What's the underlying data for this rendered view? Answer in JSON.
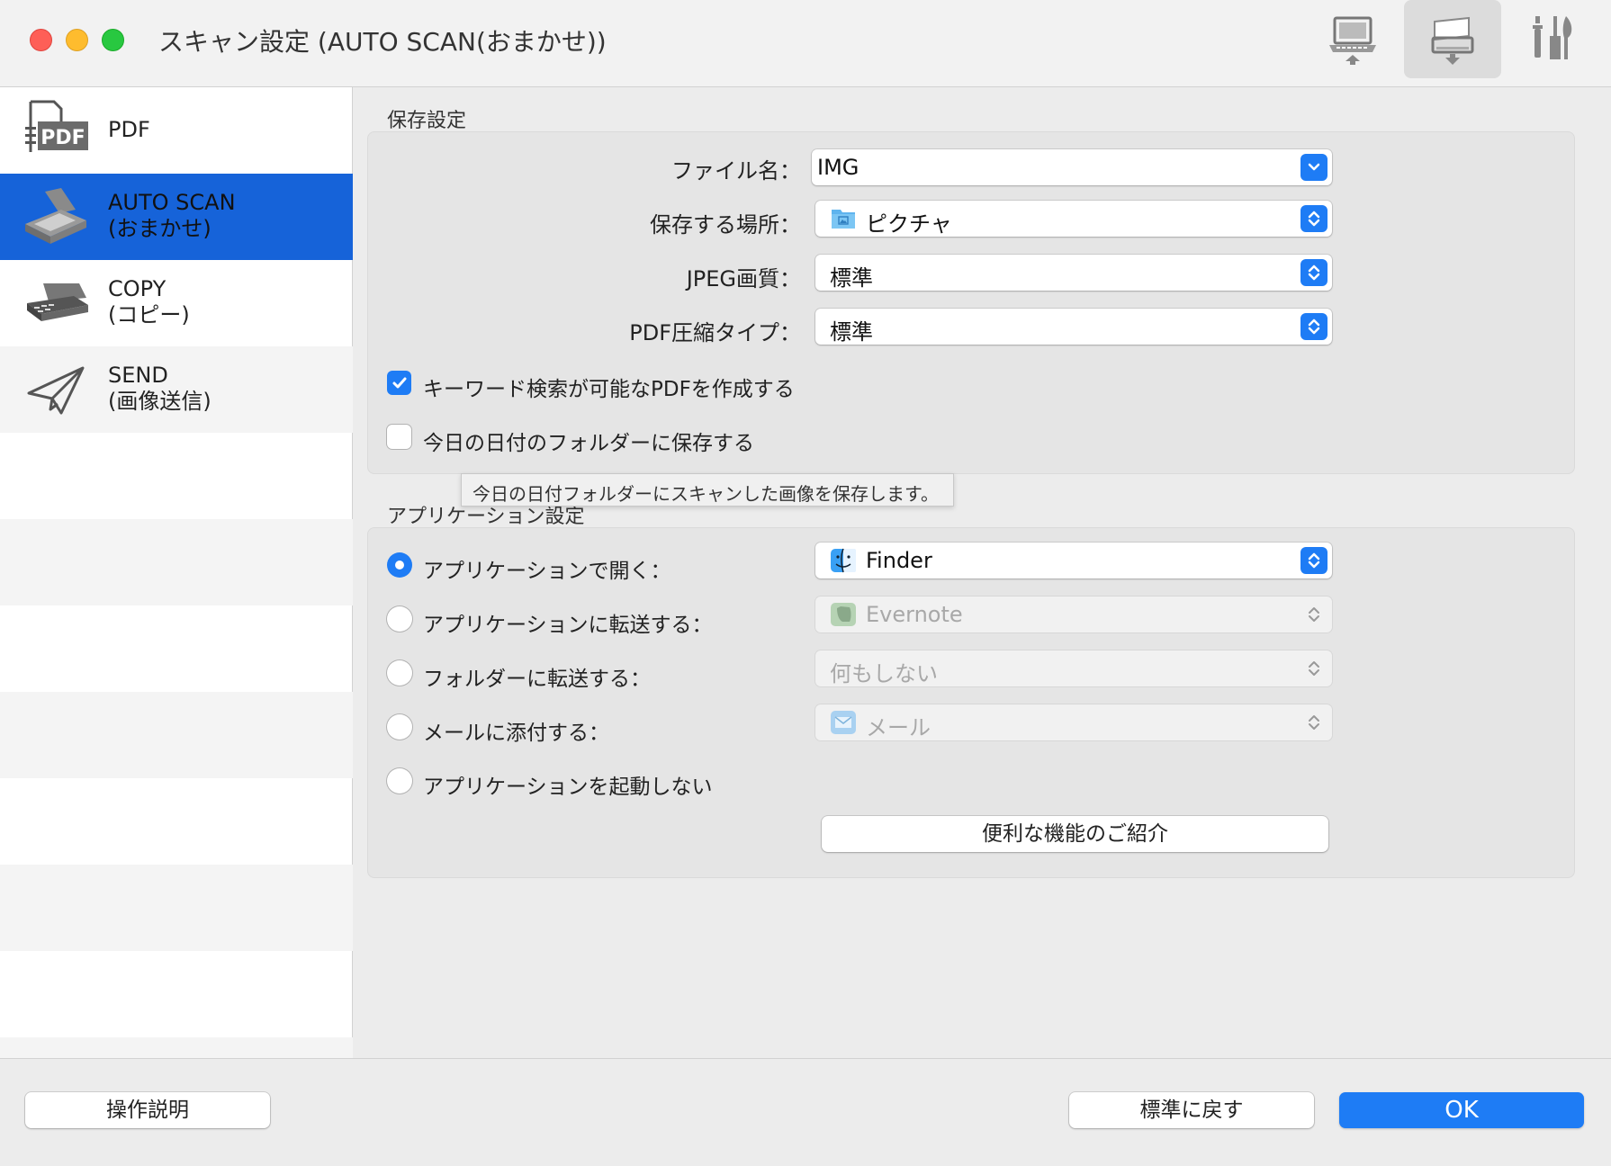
{
  "window": {
    "title": "スキャン設定 (AUTO SCAN(おまかせ))"
  },
  "toolbar": {
    "tabs": [
      {
        "name": "computer-scan",
        "icon": "computer-icon"
      },
      {
        "name": "device-scan",
        "icon": "scanner-icon",
        "selected": true
      },
      {
        "name": "general-settings",
        "icon": "tools-icon"
      }
    ]
  },
  "sidebar": {
    "items": [
      {
        "label": "PDF",
        "icon": "pdf-icon",
        "selected": false
      },
      {
        "label": "AUTO SCAN\n(おまかせ)",
        "icon": "scanner-icon",
        "selected": true
      },
      {
        "label": "COPY\n(コピー)",
        "icon": "printer-icon",
        "selected": false
      },
      {
        "label": "SEND\n(画像送信)",
        "icon": "paper-plane-icon",
        "selected": false
      }
    ]
  },
  "save_settings": {
    "section_title": "保存設定",
    "file_name_label": "ファイル名：",
    "file_name_value": "IMG",
    "save_location_label": "保存する場所：",
    "save_location_value": "ピクチャ",
    "jpeg_quality_label": "JPEG画質：",
    "jpeg_quality_value": "標準",
    "pdf_compression_label": "PDF圧縮タイプ：",
    "pdf_compression_value": "標準",
    "keyword_search_label": "キーワード検索が可能なPDFを作成する",
    "keyword_search_checked": true,
    "date_folder_label": "今日の日付のフォルダーに保存する",
    "date_folder_checked": false
  },
  "tooltip": {
    "text": "今日の日付フォルダーにスキャンした画像を保存します。"
  },
  "app_settings": {
    "section_title": "アプリケーション設定",
    "options": [
      {
        "label": "アプリケーションで開く：",
        "checked": true,
        "value": "Finder",
        "enabled": true
      },
      {
        "label": "アプリケーションに転送する：",
        "checked": false,
        "value": "Evernote",
        "enabled": false
      },
      {
        "label": "フォルダーに転送する：",
        "checked": false,
        "value": "何もしない",
        "enabled": false
      },
      {
        "label": "メールに添付する：",
        "checked": false,
        "value": "メール",
        "enabled": false
      },
      {
        "label": "アプリケーションを起動しない",
        "checked": false
      }
    ],
    "features_button": "便利な機能のご紹介"
  },
  "footer": {
    "help_button": "操作説明",
    "defaults_button": "標準に戻す",
    "ok_button": "OK"
  },
  "colors": {
    "accent": "#1e7cf5",
    "selection": "#1663d9"
  }
}
